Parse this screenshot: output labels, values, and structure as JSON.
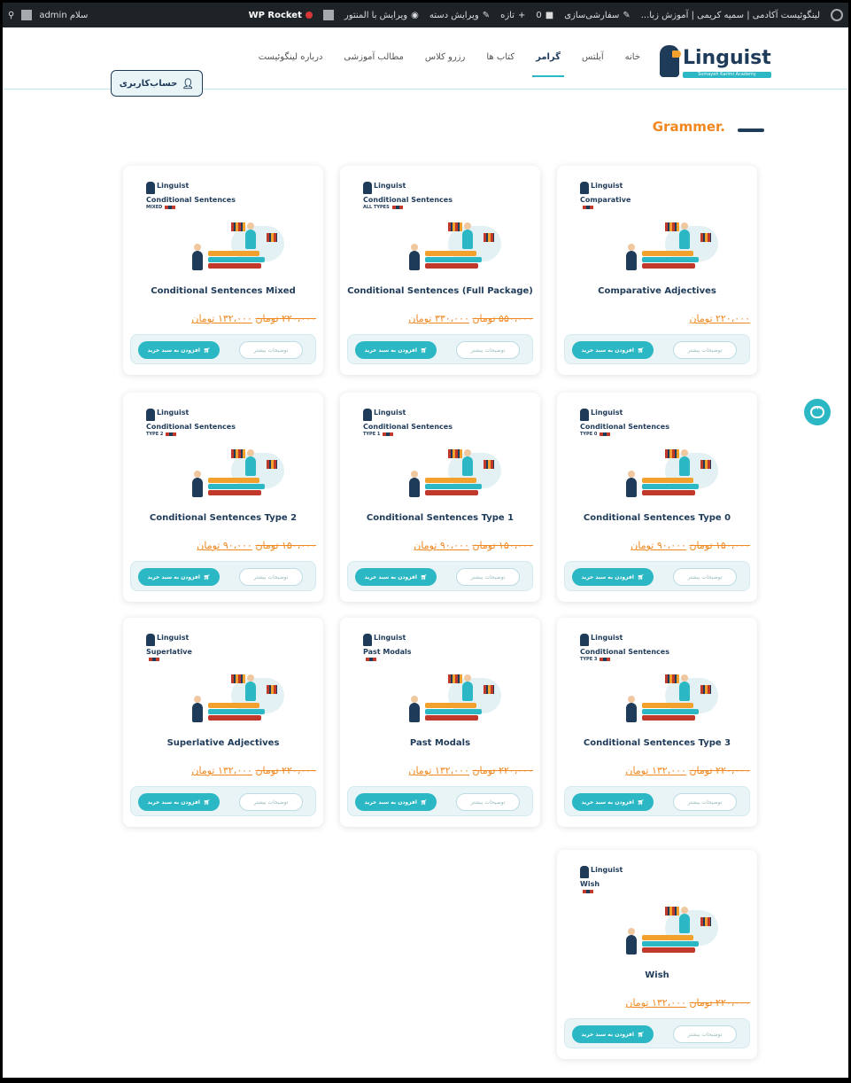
{
  "admin_bar": {
    "site_name": "لینگوئیست آکادمی | سمیه کریمی | آموزش زبا...",
    "customize": "سفارشی‌سازی",
    "comments_count": "0",
    "new": "تازه",
    "edit_category": "ویرایش دسته",
    "edit_elementor": "ویرایش با المنتور",
    "wp_rocket": "WP Rocket",
    "greeting": "سلام admin"
  },
  "header": {
    "logo_word": "Linguist",
    "logo_sub": "Somayeh Karimi Academy",
    "nav": [
      "خانه",
      "آیلتس",
      "گرامر",
      "کتاب ها",
      "رزرو کلاس",
      "مطالب آموزشی",
      "درباره لینگوئیست"
    ],
    "active_nav": "گرامر",
    "account_label": "حساب‌کاربری"
  },
  "section": {
    "title": "Grammer."
  },
  "colors": {
    "accent": "#2bb7c4",
    "navy": "#1f3b5a",
    "orange": "#f0871f"
  },
  "card_labels": {
    "more": "توضیحات بیشتر",
    "add_to_cart": "افزودن به سبد خرید"
  },
  "products": [
    {
      "title": "Conditional Sentences Mixed",
      "thumb_topic": "Conditional Sentences",
      "thumb_sub": "MIXED",
      "old_price": "۲۲۰،۰۰۰ تومان",
      "new_price": "۱۳۲،۰۰۰ تومان"
    },
    {
      "title": "Conditional Sentences (Full Package)",
      "thumb_topic": "Conditional Sentences",
      "thumb_sub": "ALL TYPES",
      "old_price": "۵۵۰،۰۰۰ تومان",
      "new_price": "۳۳۰،۰۰۰ تومان"
    },
    {
      "title": "Comparative Adjectives",
      "thumb_topic": "Comparative",
      "thumb_sub": "",
      "old_price": "",
      "new_price": "۲۲۰،۰۰۰ تومان"
    },
    {
      "title": "Conditional Sentences Type 2",
      "thumb_topic": "Conditional Sentences",
      "thumb_sub": "TYPE 2",
      "old_price": "۱۵۰،۰۰۰ تومان",
      "new_price": "۹۰،۰۰۰ تومان"
    },
    {
      "title": "Conditional Sentences Type 1",
      "thumb_topic": "Conditional Sentences",
      "thumb_sub": "TYPE 1",
      "old_price": "۱۵۰،۰۰۰ تومان",
      "new_price": "۹۰،۰۰۰ تومان"
    },
    {
      "title": "Conditional Sentences Type 0",
      "thumb_topic": "Conditional Sentences",
      "thumb_sub": "TYPE 0",
      "old_price": "۱۵۰،۰۰۰ تومان",
      "new_price": "۹۰،۰۰۰ تومان"
    },
    {
      "title": "Superlative Adjectives",
      "thumb_topic": "Superlative",
      "thumb_sub": "",
      "old_price": "۲۲۰،۰۰۰ تومان",
      "new_price": "۱۳۲،۰۰۰ تومان"
    },
    {
      "title": "Past Modals",
      "thumb_topic": "Past Modals",
      "thumb_sub": "",
      "old_price": "۲۲۰،۰۰۰ تومان",
      "new_price": "۱۳۲،۰۰۰ تومان"
    },
    {
      "title": "Conditional Sentences Type 3",
      "thumb_topic": "Conditional Sentences",
      "thumb_sub": "TYPE 3",
      "old_price": "۲۲۰،۰۰۰ تومان",
      "new_price": "۱۳۲،۰۰۰ تومان"
    },
    {
      "title": "Wish",
      "thumb_topic": "Wish",
      "thumb_sub": "",
      "old_price": "۲۲۰،۰۰۰ تومان",
      "new_price": "۱۳۲،۰۰۰ تومان"
    }
  ]
}
